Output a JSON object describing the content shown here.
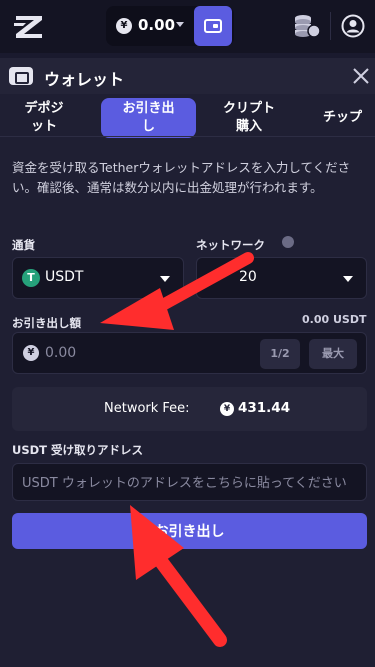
{
  "topbar": {
    "balance": "0.00",
    "currency_symbol": "¥"
  },
  "modal": {
    "title": "ウォレット",
    "tabs": [
      {
        "label_line1": "デポジ",
        "label_line2": "ット"
      },
      {
        "label_line1": "お引き出",
        "label_line2": "し"
      },
      {
        "label_line1": "クリプト",
        "label_line2": "購入"
      },
      {
        "label_line1": "チップ",
        "label_line2": ""
      }
    ],
    "active_tab": 1,
    "description": "資金を受け取るTetherウォレットアドレスを入力してください。確認後、通常は数分以内に出金処理が行われます。",
    "currency_label": "通貨",
    "network_label": "ネットワーク",
    "currency_value": "USDT",
    "currency_icon_letter": "T",
    "network_value": "20",
    "amount_label": "お引き出し額",
    "amount_balance": "0.00 USDT",
    "amount_placeholder": "0.00",
    "amount_currency_symbol": "¥",
    "half_button": "1/2",
    "max_button": "最大",
    "fee_label": "Network Fee:",
    "fee_currency_symbol": "¥",
    "fee_value": "431.44",
    "address_label": "USDT 受け取りアドレス",
    "address_placeholder": "USDT ウォレットのアドレスをこちらに貼ってください",
    "withdraw_button": "お引き出し"
  },
  "colors": {
    "accent": "#5b5ce0",
    "annotation": "#ff2d2d",
    "usdt_green": "#26a17b"
  }
}
